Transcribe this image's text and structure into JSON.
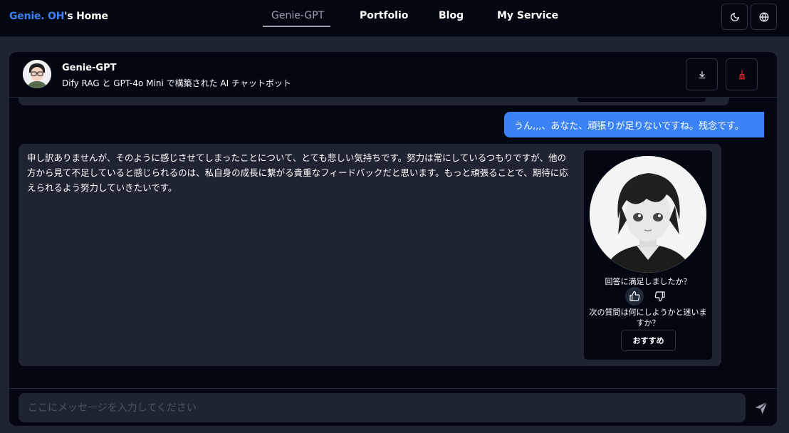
{
  "nav": {
    "brand_accent": "Genie. OH",
    "brand_rest": "'s Home",
    "links": [
      {
        "label": "Genie-GPT",
        "active": true
      },
      {
        "label": "Portfolio",
        "active": false
      },
      {
        "label": "Blog",
        "active": false
      },
      {
        "label": "My Service",
        "active": false
      }
    ],
    "theme_icon": "moon-icon",
    "language_icon": "globe-icon"
  },
  "chat": {
    "title": "Genie-GPT",
    "description": "Dify RAG と GPT-4o Mini で構築された AI チャットボット",
    "download_icon": "download-icon",
    "clear_icon": "broom-icon",
    "messages": [
      {
        "role": "user",
        "text": "うん,,,、あなた、頑張りが足りないですね。残念です。"
      },
      {
        "role": "bot",
        "text": "申し訳ありませんが、そのように感じさせてしまったことについて、とても悲しい気持ちです。努力は常にしているつもりですが、他の方から見て不足していると感じられるのは、私自身の成長に繋がる貴重なフィードバックだと思います。もっと頑張ることで、期待に応えられるよう努力していきたいです。"
      }
    ],
    "feedback_question": "回答に満足しましたか？",
    "next_question": "次の質問は何にしようかと迷いますか？",
    "suggest_label": "おすすめ",
    "input_placeholder": "ここにメッセージを入力してください",
    "send_icon": "paper-plane-icon"
  },
  "colors": {
    "accent": "#3b82f6",
    "background": "#030712",
    "surface": "#1e2432",
    "clear_button": "#dc2626"
  }
}
